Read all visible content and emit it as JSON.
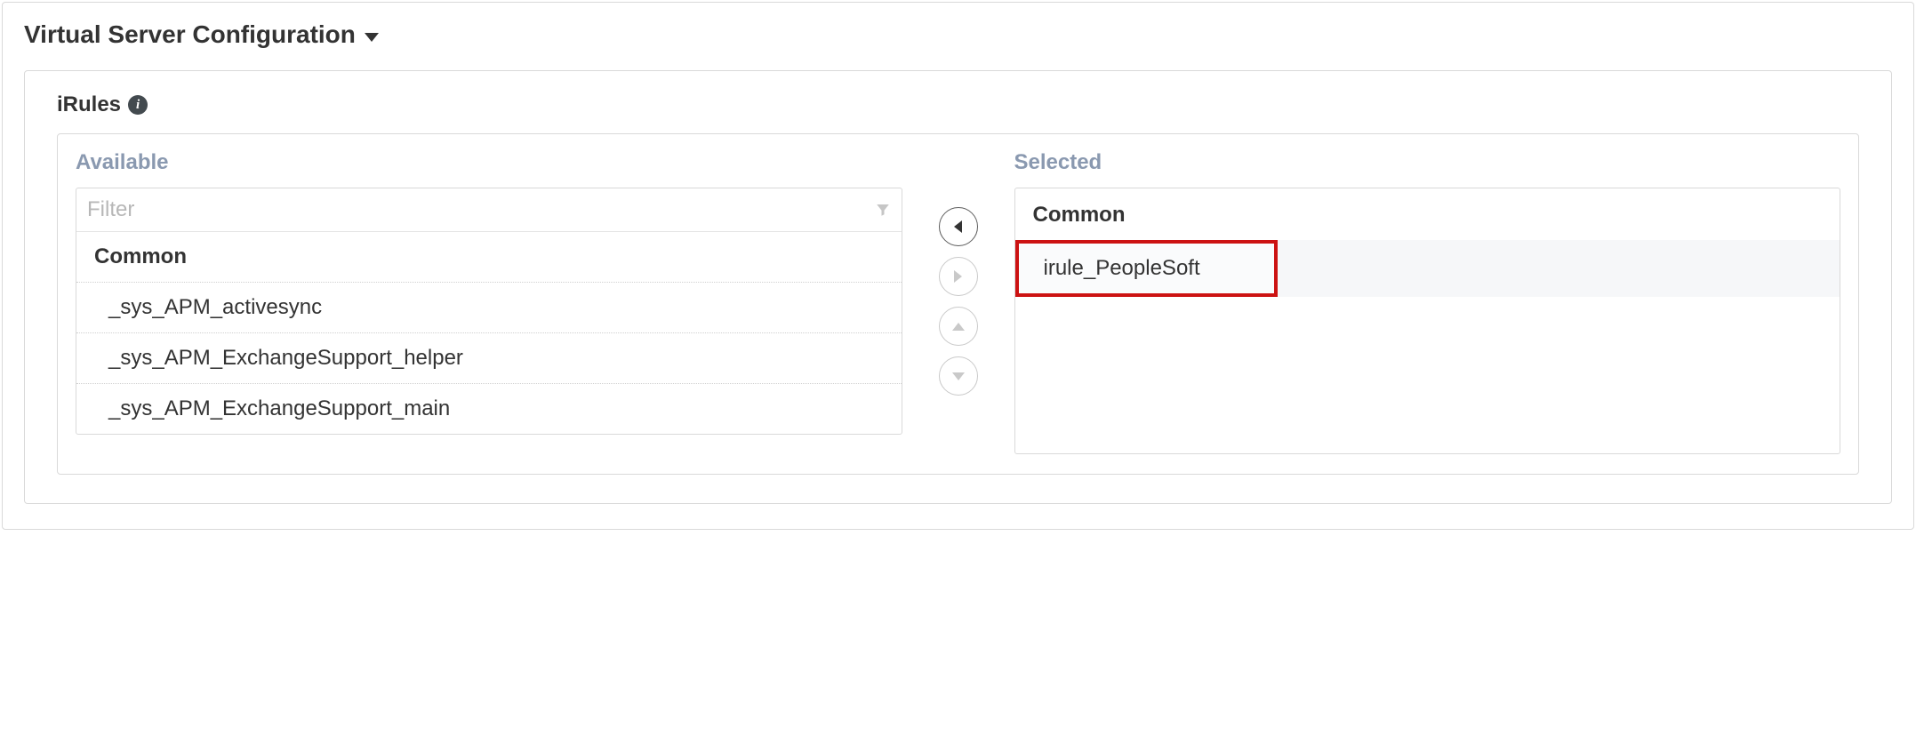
{
  "section": {
    "title": "Virtual Server Configuration"
  },
  "irules": {
    "label": "iRules",
    "available": {
      "title": "Available",
      "filter_placeholder": "Filter",
      "groups": [
        {
          "name": "Common",
          "items": [
            "_sys_APM_activesync",
            "_sys_APM_ExchangeSupport_helper",
            "_sys_APM_ExchangeSupport_main"
          ]
        }
      ]
    },
    "selected": {
      "title": "Selected",
      "groups": [
        {
          "name": "Common",
          "items": [
            "irule_PeopleSoft"
          ]
        }
      ]
    }
  }
}
